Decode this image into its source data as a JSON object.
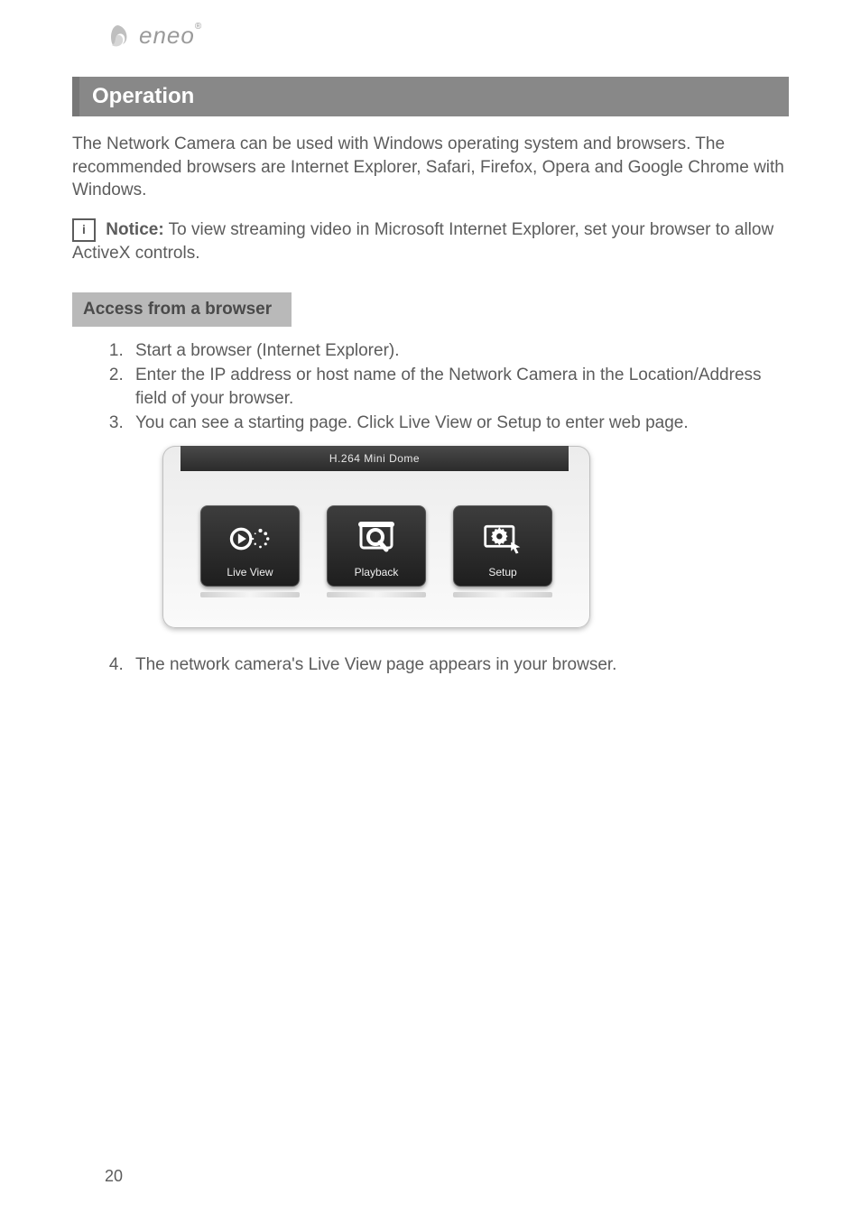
{
  "logo": {
    "brand": "eneo"
  },
  "heading1": "Operation",
  "intro": "The Network Camera can be used with Windows operating system and browsers. The recommended browsers are Internet Explorer, Safari, Firefox, Opera and Google Chrome with Windows.",
  "notice": {
    "icon_glyph": "i",
    "label": "Notice:",
    "text": " To view streaming video in Microsoft Internet Explorer, set your browser to allow ActiveX controls."
  },
  "heading2": "Access from a browser",
  "steps": [
    "Start a browser (Internet Explorer).",
    "Enter the IP address or host name of the Network Camera in the Location/Address field of your browser.",
    "You can see a starting page. Click Live View or Setup to enter web page."
  ],
  "screenshot": {
    "title": "H.264 Mini Dome",
    "tiles": [
      {
        "name": "live-view",
        "label": "Live View",
        "icon": "play-loading-icon"
      },
      {
        "name": "playback",
        "label": "Playback",
        "icon": "magnify-folder-icon"
      },
      {
        "name": "setup",
        "label": "Setup",
        "icon": "gear-picture-cursor-icon"
      }
    ]
  },
  "steps_after": [
    "The network camera's Live View page appears in your browser."
  ],
  "page_number": "20"
}
